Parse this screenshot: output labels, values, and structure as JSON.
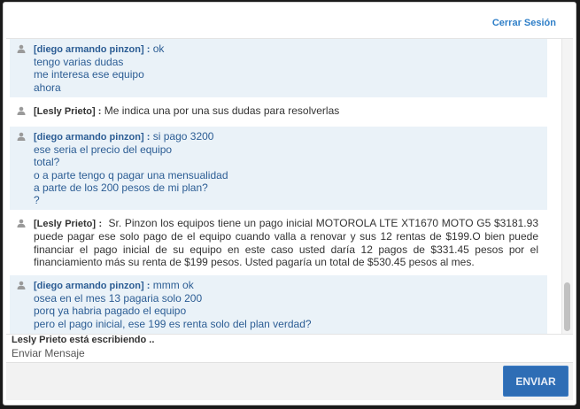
{
  "header": {
    "logout_label": "Cerrar Sesión"
  },
  "messages": [
    {
      "role": "client",
      "author": "[diego armando pinzon] :",
      "lines": [
        "ok",
        "tengo varias dudas",
        "me interesa ese equipo",
        "ahora"
      ]
    },
    {
      "role": "agent",
      "author": "[Lesly Prieto] :",
      "lines": [
        "Me indica una por una sus dudas para resolverlas"
      ]
    },
    {
      "role": "client",
      "author": "[diego armando pinzon] :",
      "lines": [
        "si pago 3200",
        "ese seria el precio del equipo",
        "total?",
        "o a parte tengo q pagar una mensualidad",
        "a parte de los 200 pesos de mi plan?",
        "?"
      ]
    },
    {
      "role": "agent",
      "author": "[Lesly Prieto] :",
      "lines": [
        "Sr. Pinzon los equipos tiene un pago inicial MOTOROLA LTE XT1670 MOTO G5 $3181.93 puede pagar ese solo pago de el equipo cuando valla a renovar y sus 12 rentas de $199.O bien puede financiar el pago inicial de su equipo en este caso usted daría 12 pagos de $331.45 pesos por el financiamiento más su renta de $199 pesos. Usted pagaría un total de $530.45 pesos al mes."
      ]
    },
    {
      "role": "client",
      "author": "[diego armando pinzon] :",
      "lines": [
        "mmm ok",
        "osea en el mes 13 pagaria solo 200",
        "porq ya habria pagado el equipo",
        "pero el pago inicial, ese 199 es renta solo del plan verdad?"
      ]
    }
  ],
  "status": {
    "typing": "Lesly Prieto está escribiendo .."
  },
  "composer": {
    "label": "Enviar Mensaje",
    "value": "",
    "send_label": "ENVIAR"
  },
  "colors": {
    "client_bg": "#eaf2f8",
    "client_text": "#2c5d94",
    "link": "#2f7fc8",
    "send_button": "#2e6db5"
  }
}
